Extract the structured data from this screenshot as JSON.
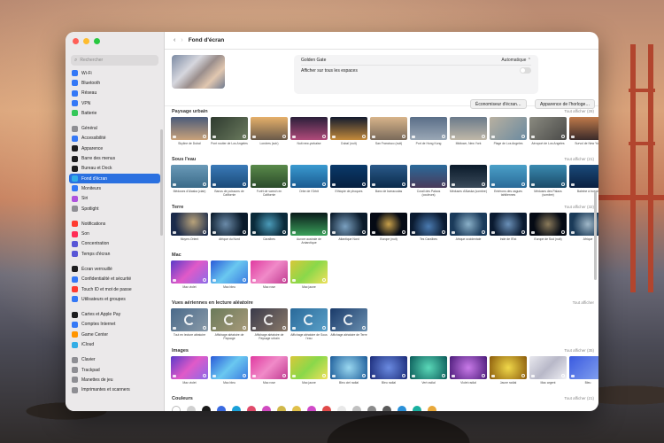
{
  "window": {
    "title": "Fond d'écran"
  },
  "sidebar": {
    "search_placeholder": "Rechercher",
    "items": [
      {
        "label": "Wi-Fi",
        "color": "#3478f6",
        "icon": "wifi-icon"
      },
      {
        "label": "Bluetooth",
        "color": "#3478f6",
        "icon": "bluetooth-icon"
      },
      {
        "label": "Réseau",
        "color": "#3478f6",
        "icon": "globe-icon"
      },
      {
        "label": "VPN",
        "color": "#3478f6",
        "icon": "vpn-icon"
      },
      {
        "label": "Batterie",
        "color": "#34c759",
        "icon": "battery-icon"
      },
      {
        "label": "Général",
        "color": "#8e8e93",
        "icon": "gear-icon",
        "gap": true
      },
      {
        "label": "Accessibilité",
        "color": "#3478f6",
        "icon": "accessibility-icon"
      },
      {
        "label": "Apparence",
        "color": "#1c1c1e",
        "icon": "appearance-icon"
      },
      {
        "label": "Barre des menus",
        "color": "#1c1c1e",
        "icon": "menubar-icon"
      },
      {
        "label": "Bureau et Dock",
        "color": "#1c1c1e",
        "icon": "dock-icon"
      },
      {
        "label": "Fond d'écran",
        "color": "#32ade6",
        "icon": "wallpaper-icon",
        "selected": true
      },
      {
        "label": "Moniteurs",
        "color": "#3478f6",
        "icon": "display-icon"
      },
      {
        "label": "Siri",
        "color": "#af52de",
        "icon": "siri-icon"
      },
      {
        "label": "Spotlight",
        "color": "#8e8e93",
        "icon": "spotlight-icon"
      },
      {
        "label": "Notifications",
        "color": "#ff3b30",
        "icon": "bell-icon",
        "gap": true
      },
      {
        "label": "Son",
        "color": "#ff2d55",
        "icon": "speaker-icon"
      },
      {
        "label": "Concentration",
        "color": "#5856d6",
        "icon": "moon-icon"
      },
      {
        "label": "Temps d'écran",
        "color": "#5856d6",
        "icon": "hourglass-icon"
      },
      {
        "label": "Écran verrouillé",
        "color": "#1c1c1e",
        "icon": "lock-screen-icon",
        "gap": true
      },
      {
        "label": "Confidentialité et sécurité",
        "color": "#3478f6",
        "icon": "hand-icon"
      },
      {
        "label": "Touch ID et mot de passe",
        "color": "#ff3b30",
        "icon": "fingerprint-icon"
      },
      {
        "label": "Utilisateurs et groupes",
        "color": "#3478f6",
        "icon": "users-icon"
      },
      {
        "label": "Cartes et Apple Pay",
        "color": "#1c1c1e",
        "icon": "wallet-icon",
        "gap": true
      },
      {
        "label": "Comptes Internet",
        "color": "#3478f6",
        "icon": "at-icon"
      },
      {
        "label": "Game Center",
        "color": "#ff9500",
        "icon": "gamecenter-icon"
      },
      {
        "label": "iCloud",
        "color": "#32ade6",
        "icon": "cloud-icon"
      },
      {
        "label": "Clavier",
        "color": "#8e8e93",
        "icon": "keyboard-icon",
        "gap": true
      },
      {
        "label": "Trackpad",
        "color": "#8e8e93",
        "icon": "trackpad-icon"
      },
      {
        "label": "Manettes de jeu",
        "color": "#8e8e93",
        "icon": "gamepad-icon"
      },
      {
        "label": "Imprimantes et scanners",
        "color": "#8e8e93",
        "icon": "printer-icon"
      }
    ]
  },
  "header": {
    "wallpaper_name": "Golden Gate",
    "mode_value": "Automatique",
    "all_spaces_label": "Afficher sur tous les espaces",
    "screensaver_button": "Économiseur d'écran…",
    "clock_button": "Apparence de l'horloge…"
  },
  "sections": [
    {
      "title": "Paysage urbain",
      "show_all": "Tout afficher (28)",
      "tiles": [
        {
          "cap": "Skyline de Dubaï",
          "bg": "linear-gradient(180deg,#4a5b7a,#c9a27a)"
        },
        {
          "cap": "Pont routier de Los Angeles",
          "bg": "linear-gradient(135deg,#2e3a2f,#6b7b5e)"
        },
        {
          "cap": "Londres (soir)",
          "bg": "linear-gradient(180deg,#e6b06a,#6a5a4a)"
        },
        {
          "cap": "Nuit new-yorkaise",
          "bg": "linear-gradient(180deg,#2a1f3a,#b04a7a)"
        },
        {
          "cap": "Dubaï (nuit)",
          "bg": "linear-gradient(180deg,#121a2e,#c48a3a)"
        },
        {
          "cap": "San Francisco (nuit)",
          "bg": "linear-gradient(180deg,#d8b48a,#7a6a5a)"
        },
        {
          "cap": "Port de Hong Kong",
          "bg": "linear-gradient(180deg,#5a6e88,#9aa7b5)"
        },
        {
          "cap": "Midtown, New York",
          "bg": "linear-gradient(180deg,#6a7a8a,#c0b8a8)"
        },
        {
          "cap": "Plage de Los Angeles",
          "bg": "linear-gradient(135deg,#b8b0a0,#6a8aa0)"
        },
        {
          "cap": "Aéroport de Los Angeles",
          "bg": "linear-gradient(135deg,#8a8a80,#4a4a48)"
        },
        {
          "cap": "Survol de New York",
          "bg": "linear-gradient(180deg,#c07a4a,#3a2a2a)"
        }
      ]
    },
    {
      "title": "Sous l'eau",
      "show_all": "Tout afficher (21)",
      "tiles": [
        {
          "cap": "Méduses d'Alaska (clair)",
          "bg": "linear-gradient(180deg,#6a9ab8,#3a6a88)"
        },
        {
          "cap": "Bancs de poissons de Californie",
          "bg": "linear-gradient(180deg,#3a7ab8,#1a4a78)"
        },
        {
          "cap": "Forêt de varech en Californie",
          "bg": "linear-gradient(180deg,#5a8a4a,#2a4a2a)"
        },
        {
          "cap": "Orbe de l'Orbit",
          "bg": "linear-gradient(180deg,#3a9ad0,#1a5a90)"
        },
        {
          "cap": "Ethiopie de phoques",
          "bg": "linear-gradient(180deg,#0a3a6a,#062040)"
        },
        {
          "cap": "Banc de barracudas",
          "bg": "linear-gradient(180deg,#2a5a8a,#0a2a4a)"
        },
        {
          "cap": "Corail des Palaos (couleurs)",
          "bg": "linear-gradient(180deg,#2a6a9a,#4a3a5a)"
        },
        {
          "cap": "Méduses d'Alaska (sombre)",
          "bg": "linear-gradient(180deg,#0a1a2a,#3a4a5a)"
        },
        {
          "cap": "Entérons des vagues tahitiennes",
          "bg": "linear-gradient(180deg,#4aa0c8,#2a6a98)"
        },
        {
          "cap": "Méduses des Palaos (sombre)",
          "bg": "linear-gradient(180deg,#3a8ab0,#1a4a68)"
        },
        {
          "cap": "Baleine à bosse",
          "bg": "linear-gradient(180deg,#1a4a7a,#0a2040)"
        }
      ]
    },
    {
      "title": "Terre",
      "show_all": "Tout afficher (32)",
      "tiles": [
        {
          "cap": "Moyen-Orient",
          "bg": "radial-gradient(circle at 60% 40%,#b8a27a,#1a2a4a 70%)"
        },
        {
          "cap": "Afrique du Nord",
          "bg": "radial-gradient(circle at 40% 50%,#6a8aa8,#0a1a2a 70%)"
        },
        {
          "cap": "Caraïbes",
          "bg": "radial-gradient(circle at 50% 50%,#4a9ab8,#0a2a3a 70%)"
        },
        {
          "cap": "Aurore australe de Antarctique",
          "bg": "linear-gradient(180deg,#0a1a1a,#3aa05a)"
        },
        {
          "cap": "Atlantique Nord",
          "bg": "radial-gradient(circle at 40% 60%,#7aa0c0,#0a1a2a 70%)"
        },
        {
          "cap": "Europe (nuit)",
          "bg": "radial-gradient(circle at 50% 50%,#c8a04a,#050a14 60%)"
        },
        {
          "cap": "Tes Caraïbes",
          "bg": "radial-gradient(circle at 50% 60%,#4a7ab0,#0a1a30 70%)"
        },
        {
          "cap": "Afrique occidentale",
          "bg": "radial-gradient(circle at 50% 50%,#8ab0c8,#1a3a5a 70%)"
        },
        {
          "cap": "Inde de l'Est",
          "bg": "radial-gradient(circle at 50% 50%,#6a90b8,#0a1a30 70%)"
        },
        {
          "cap": "Europe de Sud (nuit)",
          "bg": "radial-gradient(circle at 50% 50%,#8a7a5a,#050a14 65%)"
        },
        {
          "cap": "Afrique",
          "bg": "radial-gradient(circle at 50% 50%,#a0b8c8,#1a3a58 70%)"
        }
      ]
    },
    {
      "title": "Mac",
      "show_all": "",
      "tiles": [
        {
          "cap": "Mac violet",
          "bg": "linear-gradient(135deg,#5a3ac8,#e05ac8,#8a6ae8)"
        },
        {
          "cap": "Mac bleu",
          "bg": "linear-gradient(135deg,#2a5ad8,#6ac8f0,#3a7ae0)"
        },
        {
          "cap": "Mac rose",
          "bg": "linear-gradient(135deg,#e03aa0,#f08ac8,#c03a90)"
        },
        {
          "cap": "Mac jaune",
          "bg": "linear-gradient(135deg,#d8c83a,#8ad84a,#f0e05a)"
        }
      ]
    },
    {
      "title": "Vues aériennes en lecture aléatoire",
      "show_all": "Tout afficher",
      "tiles": [
        {
          "cap": "Tout en lecture aléatoire",
          "bg": "linear-gradient(135deg,#4a6a8a,#8a9aa8)",
          "rot": true
        },
        {
          "cap": "Affichage aléatoire de Paysage",
          "bg": "linear-gradient(135deg,#6a7a5a,#a89a7a)",
          "rot": true
        },
        {
          "cap": "Affichage aléatoire de Paysage urbain",
          "bg": "linear-gradient(135deg,#3a3a4a,#8a7a6a)",
          "rot": true
        },
        {
          "cap": "Affichage aléatoire de Sous l'eau",
          "bg": "linear-gradient(135deg,#2a6a9a,#5aa0c8)",
          "rot": true
        },
        {
          "cap": "Affichage aléatoire de Terre",
          "bg": "linear-gradient(135deg,#1a3a6a,#6a90b0)",
          "rot": true
        }
      ]
    },
    {
      "title": "Images",
      "show_all": "Tout afficher (35)",
      "tiles": [
        {
          "cap": "Mac violet",
          "bg": "linear-gradient(135deg,#5a3ac8,#e05ac8,#8a6ae8)"
        },
        {
          "cap": "Mac bleu",
          "bg": "linear-gradient(135deg,#2a5ad8,#6ac8f0,#3a7ae0)"
        },
        {
          "cap": "Mac rose",
          "bg": "linear-gradient(135deg,#e03aa0,#f08ac8,#c03a90)"
        },
        {
          "cap": "Mac jaune",
          "bg": "linear-gradient(135deg,#d8c83a,#8ad84a,#f0e05a)"
        },
        {
          "cap": "Bleu ciel radial",
          "bg": "radial-gradient(circle,#9ad8f0,#1a5a98)"
        },
        {
          "cap": "Bleu radial",
          "bg": "radial-gradient(circle,#6a8ae0,#1a2a78)"
        },
        {
          "cap": "Vert radial",
          "bg": "radial-gradient(circle,#5ad8b8,#0a5a58)"
        },
        {
          "cap": "Violet radial",
          "bg": "radial-gradient(circle,#c87ae8,#4a1a78)"
        },
        {
          "cap": "Jaune radial",
          "bg": "radial-gradient(circle,#f0d84a,#8a5a0a)"
        },
        {
          "cap": "Mac argent",
          "bg": "linear-gradient(135deg,#e8e8ee,#b8b8c8,#f0f0f5)"
        },
        {
          "cap": "Bleu",
          "bg": "linear-gradient(135deg,#3a5ae0,#8aa8f0)"
        }
      ]
    }
  ],
  "colors_section": {
    "title": "Couleurs",
    "show_all": "Tout afficher (21)",
    "swatches": [
      "#ffffff",
      "#d0d0d0",
      "#1a1a1a",
      "#3a6ae0",
      "#1aa0d8",
      "#e04a6a",
      "#d04ac0",
      "#d0b84a",
      "#e0c04a",
      "#d04ac8",
      "#e04a4a",
      "#e8e8e8",
      "#c0c0c0",
      "#8a8a8a",
      "#5a5a5a",
      "#2a90d8",
      "#1ab0a0",
      "#e8a83a"
    ]
  }
}
